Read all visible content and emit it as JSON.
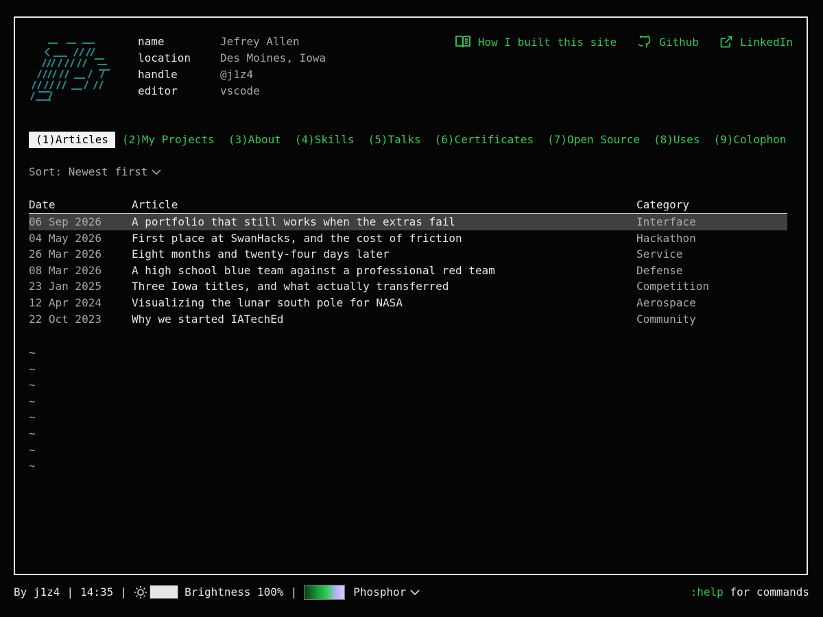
{
  "profile": {
    "rows": [
      {
        "key": "name",
        "value": "Jefrey Allen"
      },
      {
        "key": "location",
        "value": "Des Moines, Iowa"
      },
      {
        "key": "handle",
        "value": "@j1z4"
      },
      {
        "key": "editor",
        "value": "vscode"
      }
    ]
  },
  "header_links": [
    {
      "label": "How I built this site",
      "icon": "book-open-icon"
    },
    {
      "label": "Github",
      "icon": "github-icon"
    },
    {
      "label": "LinkedIn",
      "icon": "external-link-icon"
    }
  ],
  "tabs": [
    {
      "label": "(1)Articles",
      "active": true
    },
    {
      "label": "(2)My Projects"
    },
    {
      "label": "(3)About"
    },
    {
      "label": "(4)Skills"
    },
    {
      "label": "(5)Talks"
    },
    {
      "label": "(6)Certificates"
    },
    {
      "label": "(7)Open Source"
    },
    {
      "label": "(8)Uses"
    },
    {
      "label": "(9)Colophon"
    }
  ],
  "sort": {
    "label": "Sort: Newest first"
  },
  "table": {
    "headers": {
      "date": "Date",
      "article": "Article",
      "category": "Category"
    },
    "rows": [
      {
        "date": "06 Sep 2026",
        "article": "A portfolio that still works when the extras fail",
        "category": "Interface",
        "selected": true
      },
      {
        "date": "04 May 2026",
        "article": "First place at SwanHacks, and the cost of friction",
        "category": "Hackathon"
      },
      {
        "date": "26 Mar 2026",
        "article": "Eight months and twenty-four days later",
        "category": "Service"
      },
      {
        "date": "08 Mar 2026",
        "article": "A high school blue team against a professional red team",
        "category": "Defense"
      },
      {
        "date": "23 Jan 2025",
        "article": "Three Iowa titles, and what actually transferred",
        "category": "Competition"
      },
      {
        "date": "12 Apr 2024",
        "article": "Visualizing the lunar south pole for NASA",
        "category": "Aerospace"
      },
      {
        "date": "22 Oct 2023",
        "article": "Why we started IATechEd",
        "category": "Community"
      }
    ]
  },
  "tildes": [
    "~",
    "~",
    "~",
    "~",
    "~",
    "~",
    "~",
    "~"
  ],
  "status": {
    "author": "By j1z4",
    "time": "14:35",
    "brightness_bars": "█████",
    "brightness_label": "Brightness 100%",
    "brightness": 1.0,
    "theme": "Phosphor",
    "help_cmd": ":help",
    "help_text": " for commands"
  },
  "colors": {
    "accent": "#2ecc50",
    "logo": "#1f8a8a",
    "selected_row": "#404040"
  }
}
